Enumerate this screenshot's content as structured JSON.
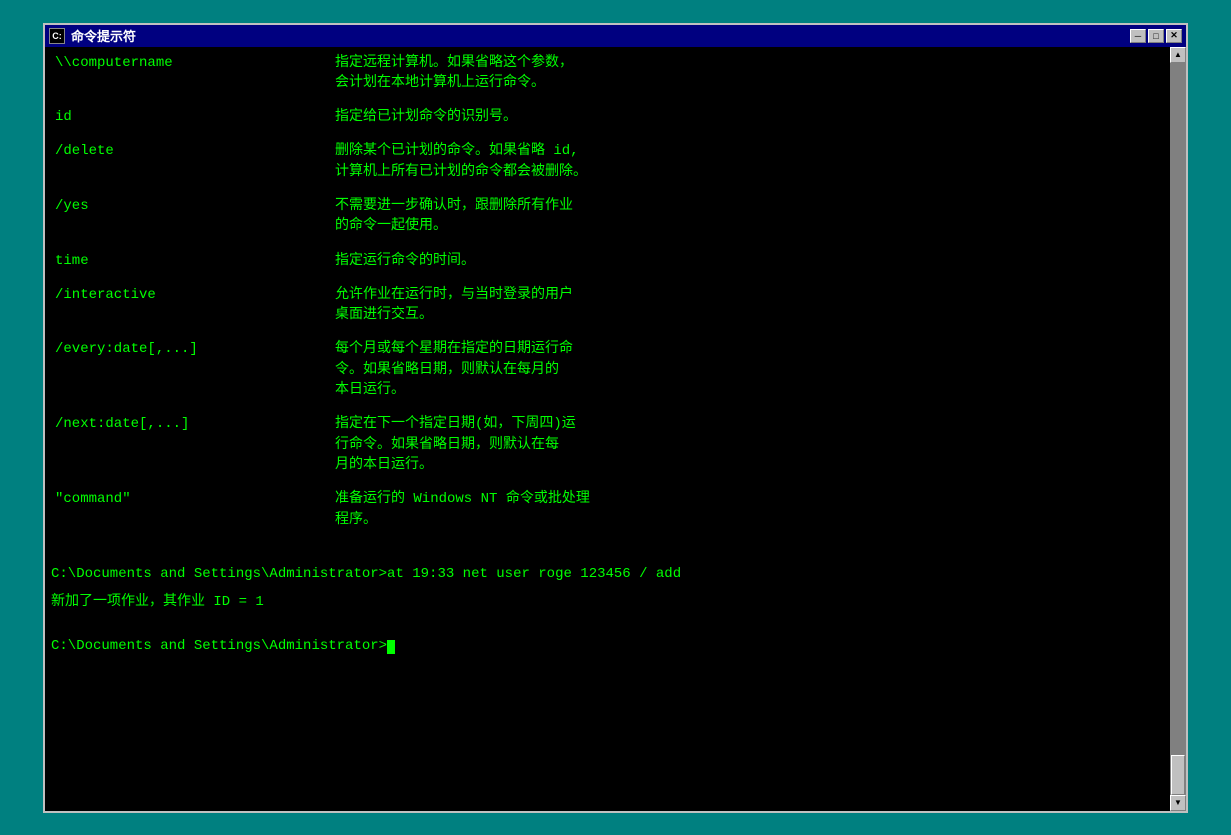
{
  "window": {
    "title": "命令提示符",
    "title_icon": "C",
    "buttons": {
      "minimize": "─",
      "maximize": "□",
      "close": "✕"
    }
  },
  "terminal": {
    "rows": [
      {
        "param": "\\\\computername",
        "desc": "指定远程计算机。如果省略这个参数，\n会计划在本地计算机上运行命令。"
      },
      {
        "param": "id",
        "desc": "指定给已计划命令的识别号。"
      },
      {
        "param": "/delete",
        "desc": "删除某个已计划的命令。如果省略 id,\n计算机上所有已计划的命令都会被删除。"
      },
      {
        "param": "/yes",
        "desc": "不需要进一步确认时，跟删除所有作业\n的命令一起使用。"
      },
      {
        "param": "time",
        "desc": "指定运行命令的时间。"
      },
      {
        "param": "/interactive",
        "desc": "允许作业在运行时，与当时登录的用户\n桌面进行交互。"
      },
      {
        "param": "/every:date[,...]",
        "desc": "每个月或每个星期在指定的日期运行命\n令。如果省略日期，则默认在每月的\n本日运行。"
      },
      {
        "param": "/next:date[,...]",
        "desc": "指定在下一个指定日期(如，下周四)运\n行命令。如果省略日期，则默认在每\n月的本日运行。"
      },
      {
        "param": "\"command\"",
        "desc": "准备运行的 Windows NT 命令或批处理\n程序。"
      }
    ],
    "command_line": "C:\\Documents and Settings\\Administrator>at 19:33 net user roge 123456 / add",
    "response_line": "新加了一项作业，其作业 ID = 1",
    "prompt_line": "C:\\Documents and Settings\\Administrator>"
  }
}
